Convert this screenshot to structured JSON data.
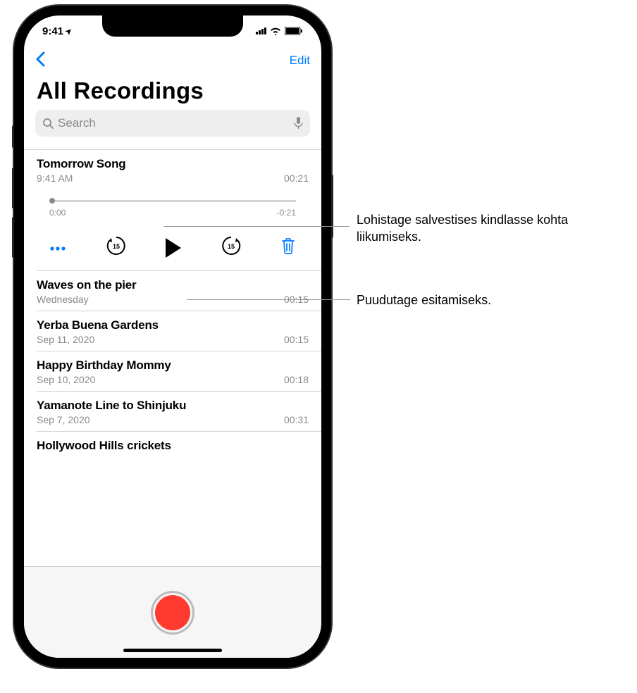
{
  "status": {
    "time": "9:41",
    "location_arrow": "➤"
  },
  "nav": {
    "edit": "Edit"
  },
  "title": "All Recordings",
  "search": {
    "placeholder": "Search"
  },
  "selected": {
    "title": "Tomorrow Song",
    "time": "9:41 AM",
    "duration": "00:21",
    "elapsed": "0:00",
    "remaining": "-0:21",
    "skip_back": "15",
    "skip_fwd": "15"
  },
  "recordings": [
    {
      "title": "Waves on the pier",
      "meta": "Wednesday",
      "duration": "00:15"
    },
    {
      "title": "Yerba Buena Gardens",
      "meta": "Sep 11, 2020",
      "duration": "00:15"
    },
    {
      "title": "Happy Birthday Mommy",
      "meta": "Sep 10, 2020",
      "duration": "00:18"
    },
    {
      "title": "Yamanote Line to Shinjuku",
      "meta": "Sep 7, 2020",
      "duration": "00:31"
    },
    {
      "title": "Hollywood Hills crickets",
      "meta": "",
      "duration": ""
    }
  ],
  "callouts": {
    "scrub": "Lohistage salvestises kindlasse kohta liikumiseks.",
    "play": "Puudutage esitamiseks."
  }
}
